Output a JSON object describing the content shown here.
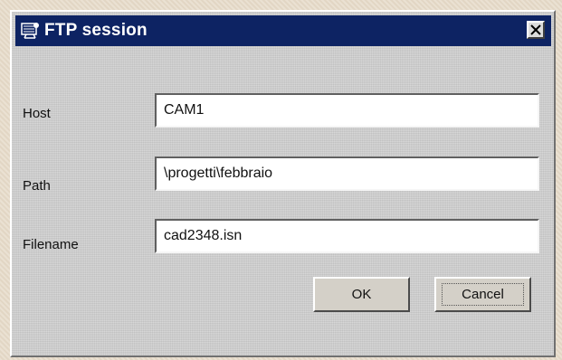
{
  "window": {
    "title": "FTP session",
    "icon": "ftp-session-icon",
    "close_icon": "close-icon"
  },
  "form": {
    "host_label": "Host",
    "host_value": "CAM1",
    "path_label": "Path",
    "path_value": "\\progetti\\febbraio",
    "filename_label": "Filename",
    "filename_value": "cad2348.isn"
  },
  "buttons": {
    "ok": "OK",
    "cancel": "Cancel"
  },
  "colors": {
    "titlebar": "#0d2363",
    "dialog": "#cfcfcf",
    "desktop": "#e6dac8"
  }
}
